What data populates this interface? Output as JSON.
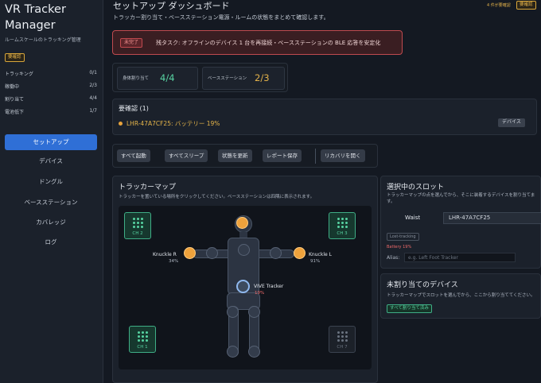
{
  "sidebar": {
    "title": "VR Tracker Manager",
    "subtitle": "ルームスケールのトラッキング管理",
    "badge": "要確認",
    "stats": [
      {
        "label": "トラッキング",
        "value": "0/1"
      },
      {
        "label": "稼働中",
        "value": "2/3"
      },
      {
        "label": "割り当て",
        "value": "4/4"
      },
      {
        "label": "電池低下",
        "value": "1/7"
      }
    ],
    "nav": [
      "セットアップ",
      "デバイス",
      "ドングル",
      "ベースステーション",
      "カバレッジ",
      "ログ"
    ],
    "active_nav": "セットアップ"
  },
  "header": {
    "title": "セットアップ ダッシュボード",
    "description": "トラッカー割り当て・ベースステーション電源・ルームの状態をまとめて確認します。",
    "count": "4 件が要確認",
    "badge": "要確認"
  },
  "alert": {
    "badge": "未完了",
    "text": "残タスク: オフラインのデバイス 1 台を再接続・ベースステーションの BLE 応答を安定化"
  },
  "stat_cards": [
    {
      "label": "身体割り当て",
      "value": "4/4",
      "color": "#57d3a2"
    },
    {
      "label": "ベースステーション",
      "value": "2/3",
      "color": "#e3b24a"
    }
  ],
  "attention": {
    "title": "要確認 (1)",
    "item": "LHR-47A7CF25: バッテリー 19%",
    "button": "デバイス"
  },
  "toolbar": [
    "すべて起動",
    "すべてスリープ",
    "状態を更新",
    "レポート保存",
    "リカバリを開く"
  ],
  "tracker_map": {
    "title": "トラッカーマップ",
    "description": "トラッカーを置いている場所をクリックしてください。ベースステーションは四隅に表示されます。",
    "stations": [
      {
        "label": "CH 2",
        "status": "on"
      },
      {
        "label": "CH 3",
        "status": "on"
      },
      {
        "label": "CH 1",
        "status": "on"
      },
      {
        "label": "CH 7",
        "status": "off"
      }
    ],
    "trackers": {
      "knuckle_r": {
        "name": "Knuckle R",
        "battery": "34%"
      },
      "knuckle_l": {
        "name": "Knuckle L",
        "battery": "91%"
      },
      "vive": {
        "name": "VIVE Tracker",
        "battery": "19%"
      }
    }
  },
  "selected_slot": {
    "title": "選択中のスロット",
    "description": "トラッカーマップの点を選んでから、そこに装着するデバイスを割り当てます。",
    "slot": "Waist",
    "device": "LHR-47A7CF25",
    "status_badge": "Lost-tracking",
    "battery": "Battery 19%",
    "alias_label": "Alias:",
    "alias_placeholder": "e.g. Left Foot Tracker"
  },
  "unassigned": {
    "title": "未割り当てのデバイス",
    "description": "トラッカーマップでスロットを選んでから、ここから割り当ててください。",
    "button": "すべて割り当て済み"
  },
  "colors": {
    "accent": "#2f6fd6",
    "warning": "#e3b24a",
    "danger": "#c04a4f",
    "success": "#57d3a2"
  }
}
